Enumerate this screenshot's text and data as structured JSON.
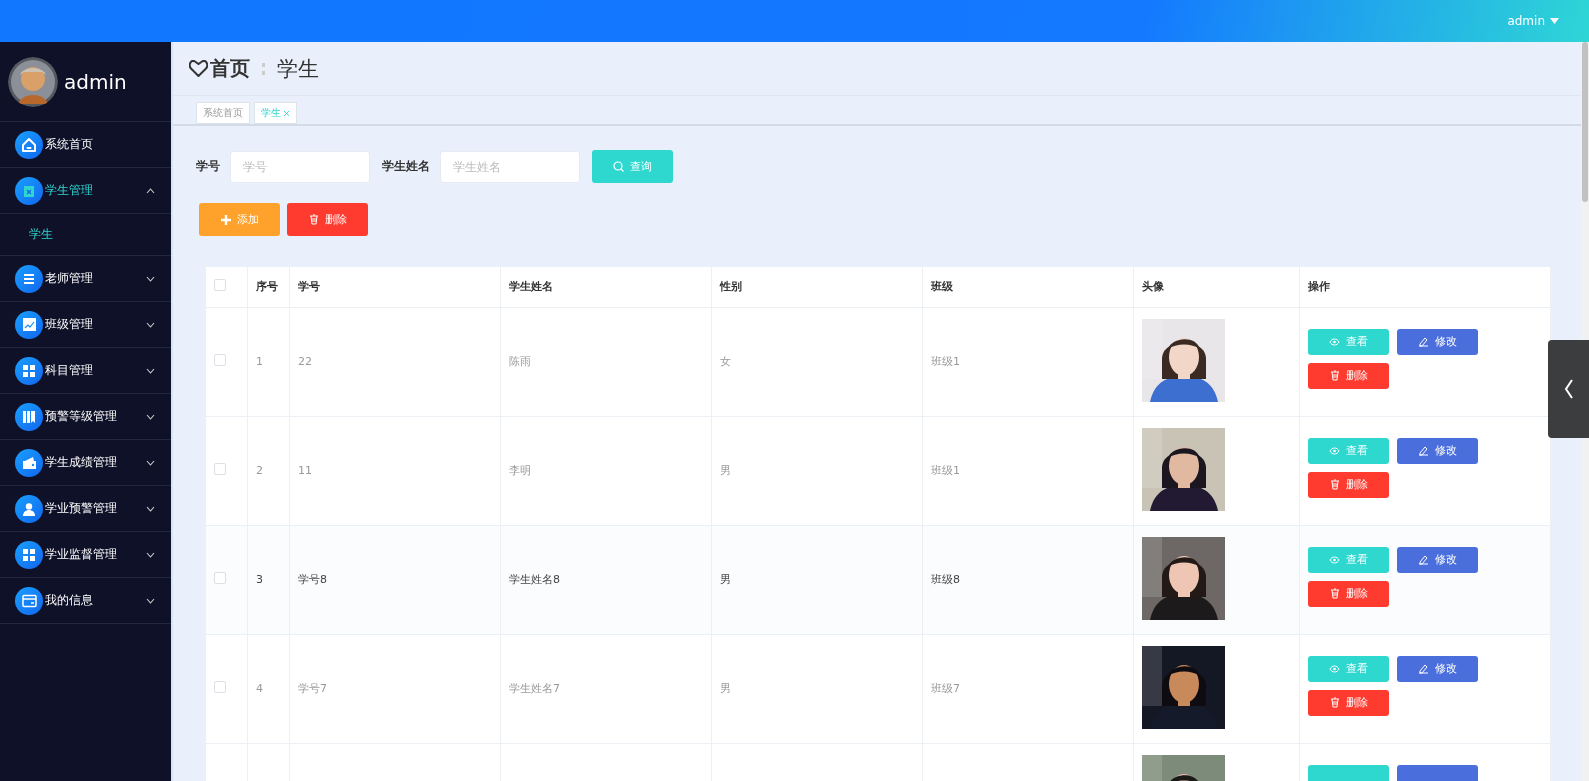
{
  "topbar": {
    "user": "admin"
  },
  "sidebar": {
    "user": "admin",
    "items": [
      {
        "label": "系统首页",
        "kind": "link"
      },
      {
        "label": "学生管理",
        "kind": "menu",
        "expanded": true,
        "children": [
          {
            "label": "学生",
            "selected": true
          }
        ]
      },
      {
        "label": "老师管理",
        "kind": "menu",
        "expanded": false
      },
      {
        "label": "班级管理",
        "kind": "menu",
        "expanded": false
      },
      {
        "label": "科目管理",
        "kind": "menu",
        "expanded": false
      },
      {
        "label": "预警等级管理",
        "kind": "menu",
        "expanded": false
      },
      {
        "label": "学生成绩管理",
        "kind": "menu",
        "expanded": false
      },
      {
        "label": "学业预警管理",
        "kind": "menu",
        "expanded": false
      },
      {
        "label": "学业监督管理",
        "kind": "menu",
        "expanded": false
      },
      {
        "label": "我的信息",
        "kind": "menu",
        "expanded": false
      }
    ]
  },
  "breadcrumb": [
    "首页",
    "学生"
  ],
  "tabs": [
    {
      "label": "系统首页",
      "selected": false
    },
    {
      "label": "学生",
      "selected": true
    }
  ],
  "search": {
    "fields": [
      {
        "label": "学号",
        "placeholder": "学号"
      },
      {
        "label": "学生姓名",
        "placeholder": "学生姓名"
      }
    ],
    "button": "查询"
  },
  "toolbar": [
    {
      "kind": "add",
      "label": "添加"
    },
    {
      "kind": "delete",
      "label": "删除"
    }
  ],
  "table": {
    "columns": [
      "序号",
      "学号",
      "学生姓名",
      "性别",
      "班级",
      "头像",
      "操作"
    ],
    "header_checked": false,
    "rows": [
      {
        "checked": false,
        "hovered": false,
        "index": "1",
        "student_id": "22",
        "name": "陈雨",
        "gender": "女",
        "class": "班级1",
        "avatar": {
          "kind": "picture"
        },
        "actions": [
          {
            "kind": "view",
            "label": "查看"
          },
          {
            "kind": "edit",
            "label": "修改"
          },
          {
            "kind": "delete",
            "label": "删除"
          }
        ]
      },
      {
        "checked": false,
        "hovered": false,
        "index": "2",
        "student_id": "11",
        "name": "李明",
        "gender": "男",
        "class": "班级1",
        "avatar": {
          "kind": "picture"
        },
        "actions": [
          {
            "kind": "view",
            "label": "查看"
          },
          {
            "kind": "edit",
            "label": "修改"
          },
          {
            "kind": "delete",
            "label": "删除"
          }
        ]
      },
      {
        "checked": false,
        "hovered": true,
        "index": "3",
        "student_id": "学号8",
        "name": "学生姓名8",
        "gender": "男",
        "class": "班级8",
        "avatar": {
          "kind": "picture"
        },
        "actions": [
          {
            "kind": "view",
            "label": "查看"
          },
          {
            "kind": "edit",
            "label": "修改"
          },
          {
            "kind": "delete",
            "label": "删除"
          }
        ]
      },
      {
        "checked": false,
        "hovered": false,
        "index": "4",
        "student_id": "学号7",
        "name": "学生姓名7",
        "gender": "男",
        "class": "班级7",
        "avatar": {
          "kind": "picture"
        },
        "actions": [
          {
            "kind": "view",
            "label": "查看"
          },
          {
            "kind": "edit",
            "label": "修改"
          },
          {
            "kind": "delete",
            "label": "删除"
          }
        ]
      },
      {
        "avatar": {
          "kind": "picture"
        },
        "actions": [
          {
            "kind": "view"
          },
          {
            "kind": "edit"
          }
        ]
      }
    ]
  }
}
